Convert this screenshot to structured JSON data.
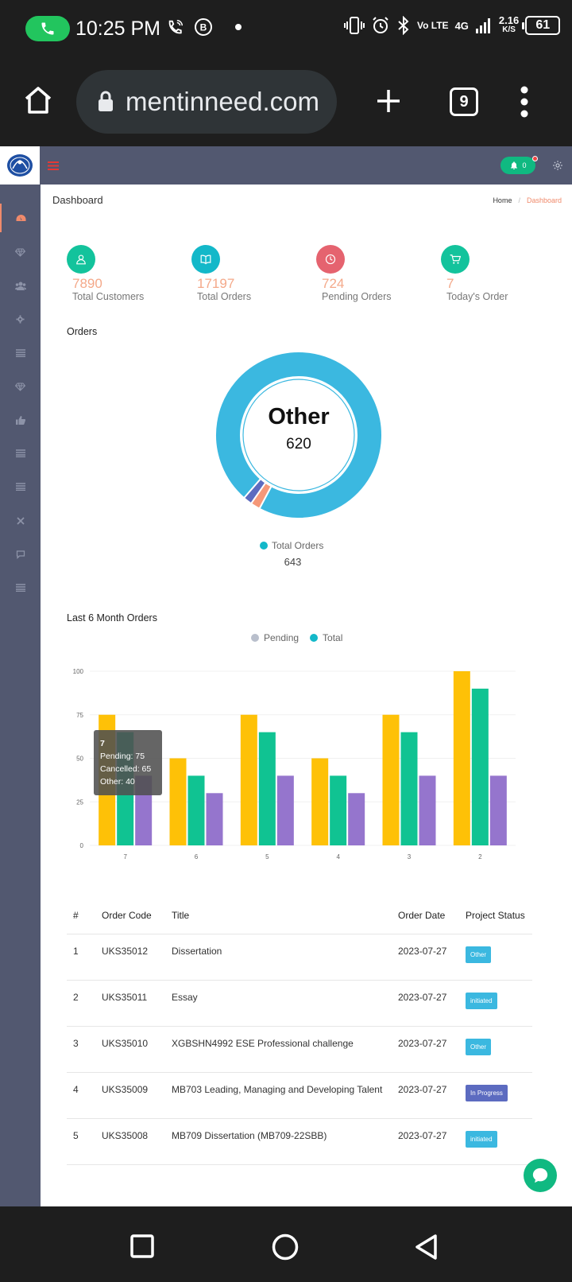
{
  "status_bar": {
    "time": "10:25 PM",
    "network_label": "Vo LTE",
    "network_gen": "4G",
    "speed_value": "2.16",
    "speed_unit": "K/S",
    "battery": "61"
  },
  "browser": {
    "url": "mentinneed.com",
    "tab_count": "9"
  },
  "header": {
    "notification_count": "0"
  },
  "page": {
    "title": "Dashboard",
    "breadcrumb": [
      "Home",
      "Dashboard"
    ]
  },
  "stats": [
    {
      "value": "7890",
      "label": "Total Customers",
      "icon": "user-icon",
      "color": "#13c39c"
    },
    {
      "value": "17197",
      "label": "Total Orders",
      "icon": "book-icon",
      "color": "#13b8c9"
    },
    {
      "value": "724",
      "label": "Pending Orders",
      "icon": "clock-icon",
      "color": "#e5636f"
    },
    {
      "value": "7",
      "label": "Today's Order",
      "icon": "cart-icon",
      "color": "#13c39c"
    }
  ],
  "donut": {
    "section_title": "Orders",
    "center_label": "Other",
    "center_value": "620",
    "legend_label": "Total Orders",
    "legend_value": "643",
    "colors": {
      "main": "#3bb8e0",
      "small1": "#f59879",
      "small2": "#5c6bc0"
    }
  },
  "bar_chart": {
    "section_title": "Last 6 Month Orders",
    "legend": [
      {
        "name": "Pending",
        "color": "#b9bfcc"
      },
      {
        "name": "Total",
        "color": "#13b8c9"
      }
    ],
    "tooltip": {
      "title": "7",
      "lines": [
        "Pending: 75",
        "Cancelled: 65",
        "Other: 40"
      ]
    }
  },
  "chart_data": [
    {
      "type": "pie",
      "title": "Orders",
      "categories": [
        "Other",
        "",
        ""
      ],
      "values": [
        620,
        12,
        11
      ],
      "total": 643,
      "legend": [
        "Total Orders"
      ]
    },
    {
      "type": "bar",
      "title": "Last 6 Month Orders",
      "categories": [
        "7",
        "6",
        "5",
        "4",
        "3",
        "2"
      ],
      "series": [
        {
          "name": "Pending",
          "values": [
            75,
            50,
            75,
            50,
            75,
            100
          ],
          "color": "#fec107"
        },
        {
          "name": "Cancelled",
          "values": [
            65,
            40,
            65,
            40,
            65,
            90
          ],
          "color": "#10c392"
        },
        {
          "name": "Other",
          "values": [
            40,
            30,
            40,
            30,
            40,
            40
          ],
          "color": "#9575cd"
        }
      ],
      "yticks": [
        0,
        25,
        50,
        75,
        100
      ],
      "ylim": [
        0,
        100
      ],
      "grid": true,
      "legend_position": "top"
    }
  ],
  "table": {
    "headers": [
      "#",
      "Order Code",
      "Title",
      "Order Date",
      "Project Status"
    ],
    "rows": [
      {
        "num": "1",
        "code": "UKS35012",
        "title": "Dissertation",
        "date": "2023-07-27",
        "status": "Other",
        "status_color": "#3bb8e0"
      },
      {
        "num": "2",
        "code": "UKS35011",
        "title": "Essay",
        "date": "2023-07-27",
        "status": "initiated",
        "status_color": "#3bb8e0"
      },
      {
        "num": "3",
        "code": "UKS35010",
        "title": "XGBSHN4992 ESE Professional challenge",
        "date": "2023-07-27",
        "status": "Other",
        "status_color": "#3bb8e0"
      },
      {
        "num": "4",
        "code": "UKS35009",
        "title": "MB703 Leading, Managing and Developing Talent",
        "date": "2023-07-27",
        "status": "In Progress",
        "status_color": "#5c6bc0"
      },
      {
        "num": "5",
        "code": "UKS35008",
        "title": "MB709 Dissertation (MB709-22SBB)",
        "date": "2023-07-27",
        "status": "initiated",
        "status_color": "#3bb8e0"
      }
    ]
  }
}
